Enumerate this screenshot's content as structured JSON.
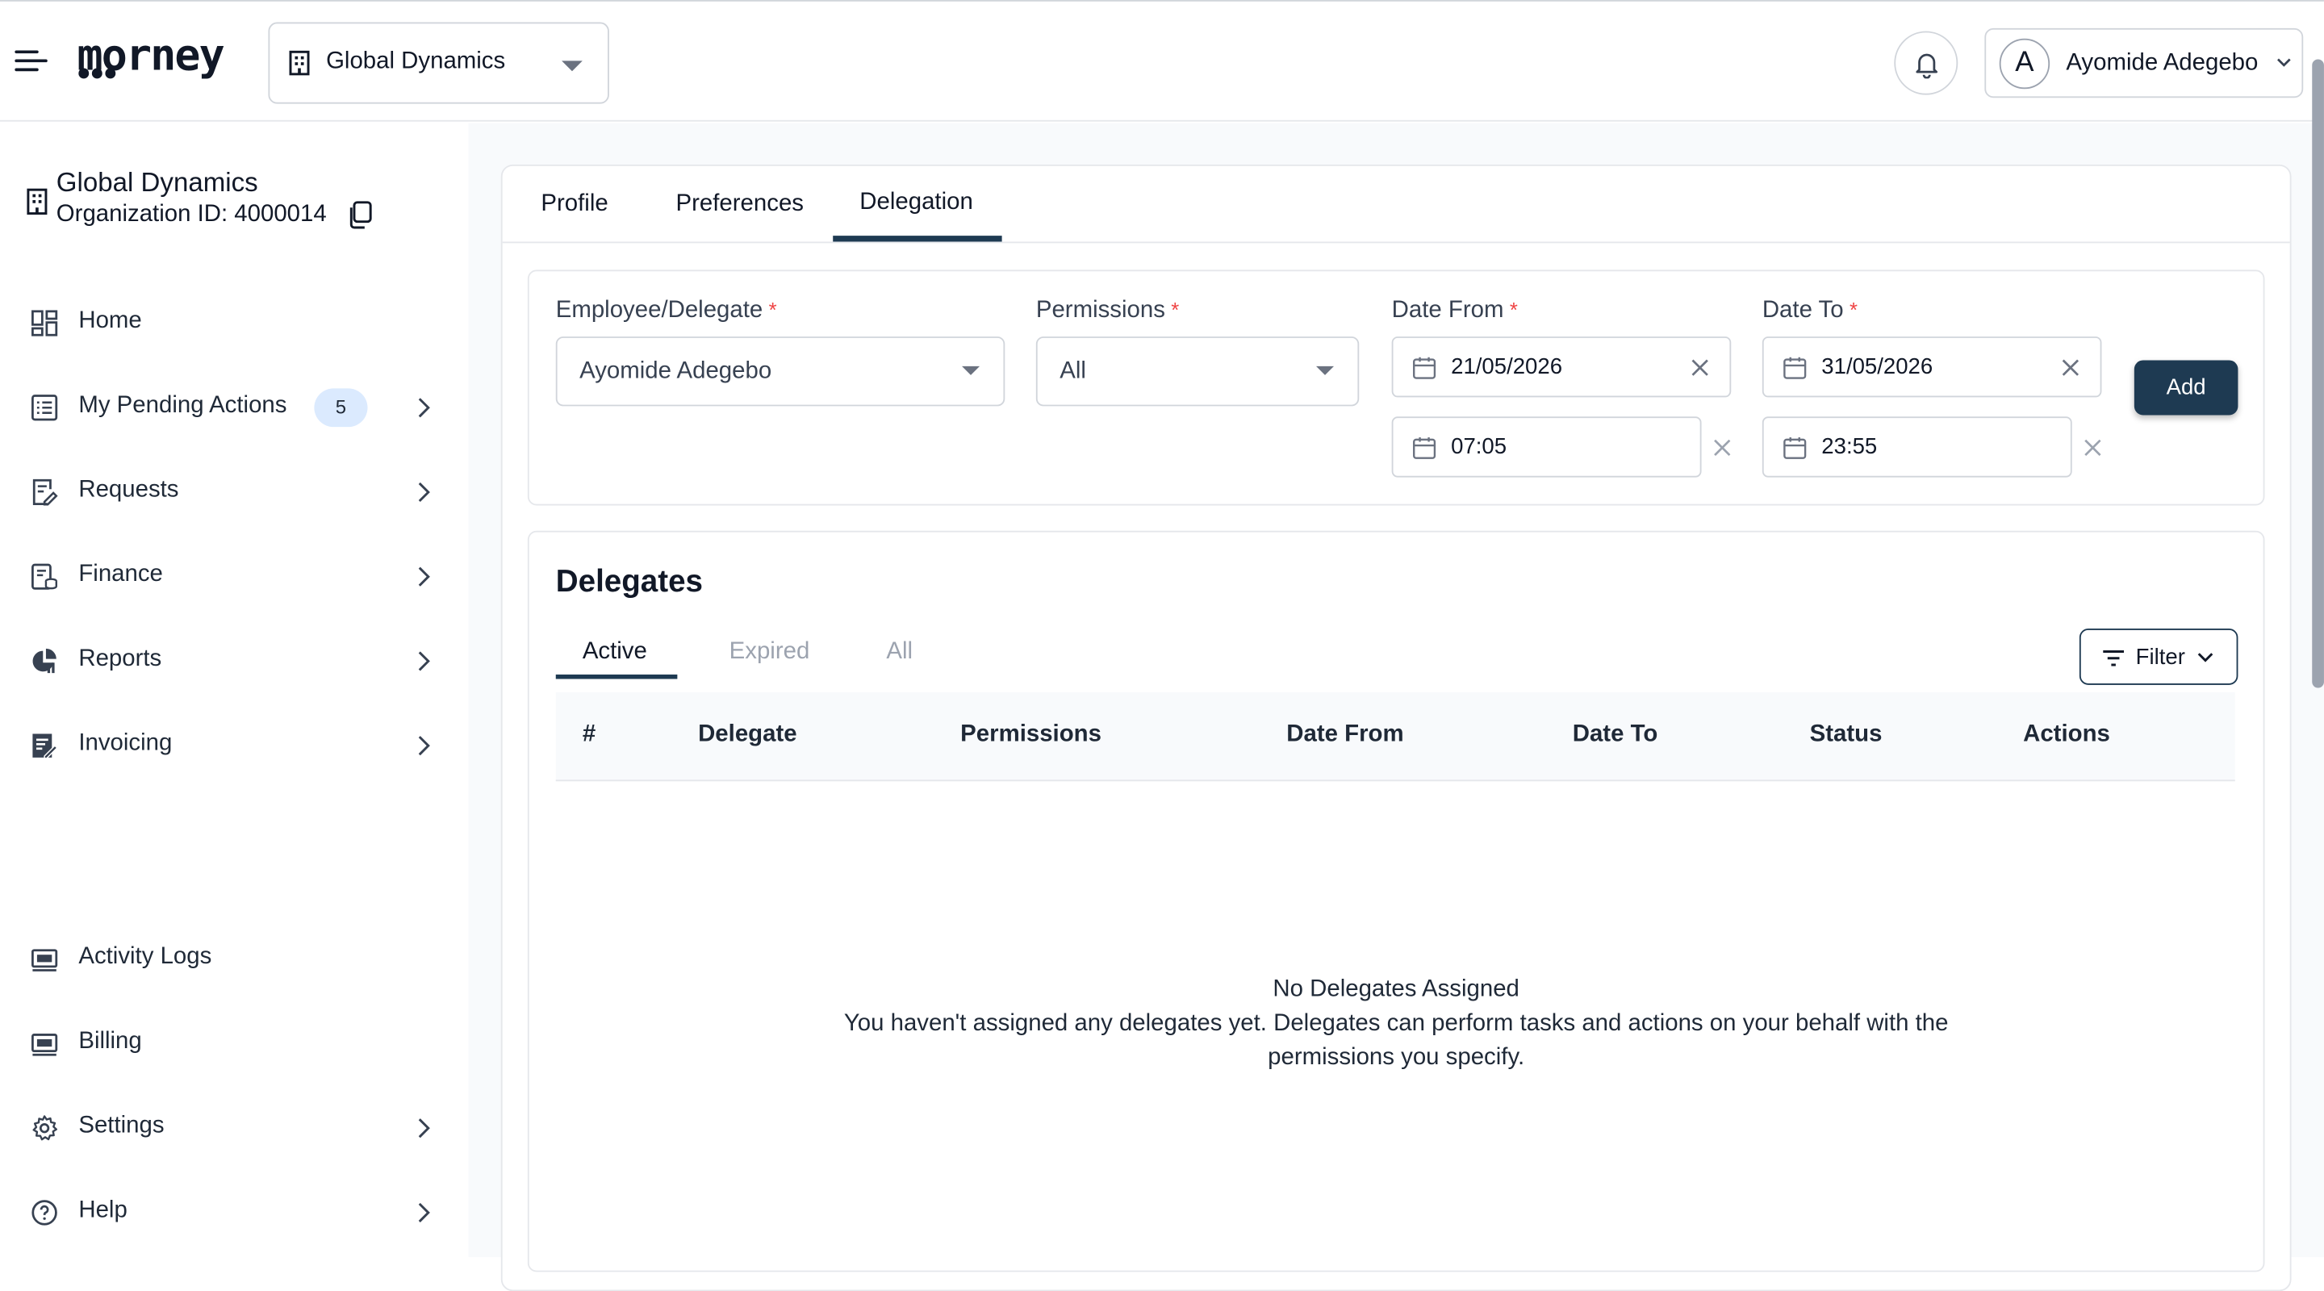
{
  "header": {
    "logo_text": "morney",
    "org_selector_value": "Global Dynamics",
    "user_initial": "A",
    "user_name": "Ayomide Adegebo"
  },
  "sidebar": {
    "org_name": "Global Dynamics",
    "org_id_label": "Organization ID: 4000014",
    "items": [
      {
        "label": "Home",
        "icon": "dashboard-icon"
      },
      {
        "label": "My Pending Actions",
        "icon": "list-icon",
        "badge": "5"
      },
      {
        "label": "Requests",
        "icon": "edit-document-icon"
      },
      {
        "label": "Finance",
        "icon": "finance-icon"
      },
      {
        "label": "Reports",
        "icon": "pie-chart-icon"
      },
      {
        "label": "Invoicing",
        "icon": "invoice-icon"
      },
      {
        "label": "Activity Logs",
        "icon": "activity-icon"
      },
      {
        "label": "Billing",
        "icon": "billing-icon"
      },
      {
        "label": "Settings",
        "icon": "gear-icon"
      },
      {
        "label": "Help",
        "icon": "help-icon"
      }
    ]
  },
  "tabs": {
    "profile": "Profile",
    "preferences": "Preferences",
    "delegation": "Delegation",
    "active": "Delegation"
  },
  "form": {
    "employee_label": "Employee/Delegate",
    "employee_value": "Ayomide Adegebo",
    "permissions_label": "Permissions",
    "permissions_value": "All",
    "date_from_label": "Date From",
    "date_from_value": "21/05/2026",
    "time_from_value": "07:05",
    "date_to_label": "Date To",
    "date_to_value": "31/05/2026",
    "time_to_value": "23:55",
    "required_mark": "*",
    "add_label": "Add"
  },
  "delegates": {
    "title": "Delegates",
    "subtabs": [
      "Active",
      "Expired",
      "All"
    ],
    "active_subtab": "Active",
    "filter_label": "Filter",
    "columns": [
      "#",
      "Delegate",
      "Permissions",
      "Date From",
      "Date To",
      "Status",
      "Actions"
    ],
    "rows": [],
    "empty_title": "No Delegates Assigned",
    "empty_line1": "You haven't assigned any delegates yet. Delegates can perform tasks and actions on your behalf with the",
    "empty_line2": "permissions you specify."
  },
  "colors": {
    "accent": "#1e3a52",
    "required": "#ef4444",
    "badge_bg": "#dbeafe",
    "muted_tab": "#9ca3af"
  }
}
